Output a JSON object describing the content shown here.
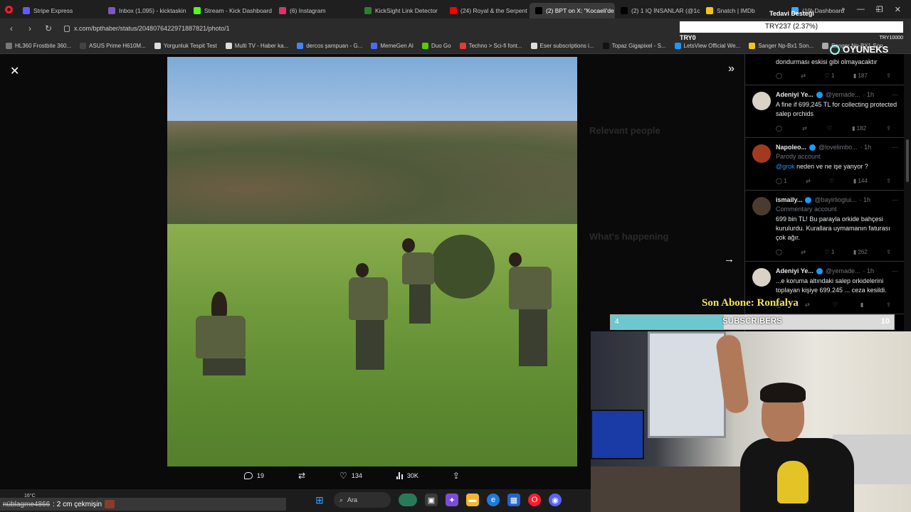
{
  "browser": {
    "tabs": [
      {
        "label": "Stripe Express",
        "color": "#635bff",
        "active": false
      },
      {
        "label": "Inbox (1,095) - kicktaskin",
        "color": "#7e57c2",
        "active": false
      },
      {
        "label": "Stream - Kick Dashboard",
        "color": "#53fc18",
        "active": false
      },
      {
        "label": "(6) Instagram",
        "color": "#e1306c",
        "active": false
      },
      {
        "label": "KickSight Link Detector",
        "color": "#2e7d32",
        "active": false
      },
      {
        "label": "(24) Royal & the Serpent",
        "color": "#ff0000",
        "active": false
      },
      {
        "label": "(2) BPT on X: \"Kocaeli'de",
        "color": "#000000",
        "active": true
      },
      {
        "label": "(2) 1 IQ İNSANLAR (@1c",
        "color": "#000000",
        "active": false
      },
      {
        "label": "Snatch | IMDb",
        "color": "#f5c518",
        "active": false
      },
      {
        "label": "(10) Dashboard",
        "color": "#3ea6ff",
        "active": false
      }
    ],
    "new_tab": "+",
    "url": "x.com/bpthaber/status/2048076422971887821/photo/1",
    "bookmarks": [
      {
        "label": "HL360 Frostbite 360...",
        "color": "#777"
      },
      {
        "label": "ASUS Prime H610M...",
        "color": "#444"
      },
      {
        "label": "Yorgunluk Tespit Test",
        "color": "#ddd"
      },
      {
        "label": "Multi TV - Haber ka...",
        "color": "#ddd"
      },
      {
        "label": "dercos şampuan - G...",
        "color": "#4285f4"
      },
      {
        "label": "MemeGen AI",
        "color": "#4a6cf7"
      },
      {
        "label": "Duo Go",
        "color": "#58cc02"
      },
      {
        "label": "Techno > Sci-fi font...",
        "color": "#e53935"
      },
      {
        "label": "Eser subscriptions i...",
        "color": "#ddd"
      },
      {
        "label": "Topaz Gigapixel - S...",
        "color": "#111"
      },
      {
        "label": "LetsView Official We...",
        "color": "#2196f3"
      },
      {
        "label": "Sanger Np-Bx1 Son...",
        "color": "#f5c518"
      },
      {
        "label": "Sanger Np-BX1 Son...",
        "color": "#aaa"
      }
    ]
  },
  "post": {
    "actions": {
      "replies": "19",
      "likes": "134",
      "views": "30K"
    }
  },
  "background_sidebar": {
    "relevant_people": "Relevant people",
    "whats_happening": "What's happening"
  },
  "replies": {
    "top_fragment": "dondurması eskisi gibi olmayacaktır",
    "top_views": "187",
    "items": [
      {
        "name": "Adeniyi Ye...",
        "handle": "@yemade...",
        "time": "· 1h",
        "label": "",
        "mention": "",
        "text": "A fine if 699,245 TL for collecting protected salep orchids",
        "reply_count": "",
        "like_count": "",
        "views": "182",
        "avatar_color": "#d9d2c5"
      },
      {
        "name": "Napoleo...",
        "handle": "@lovelimbo...",
        "time": "· 1h",
        "label": "Parody account",
        "mention": "@grok",
        "text": " neden ve ne işe yanyor ?",
        "reply_count": "1",
        "like_count": "",
        "views": "144",
        "avatar_color": "#a33a1f"
      },
      {
        "name": "ismaily...",
        "handle": "@bayirliogiui...",
        "time": "· 1h",
        "label": "Commentary account",
        "mention": "",
        "text": "699 bin TL! Bu parayla orkide bahçesi kurulurdu. Kurallara uymamanın faturası çok ağır.",
        "reply_count": "",
        "like_count": "1",
        "views": "262",
        "avatar_color": "#4b3a2e"
      },
      {
        "name": "Adeniyi Ye...",
        "handle": "@yemade...",
        "time": "· 1h",
        "label": "",
        "mention": "",
        "text": "...e koruma altındaki salep orkidelerini toplayan kişiye 699.245 ... ceza kesildi.",
        "reply_count": "",
        "like_count": "",
        "views": "",
        "avatar_color": "#d9d2c5"
      }
    ],
    "first_likes": "1"
  },
  "stream": {
    "ticker_title": "Tedavi Desteği",
    "ticker_value": "TRY237 (2.37%)",
    "ticker_left": "TRY0",
    "ticker_right": "TRY10000",
    "brand": "OYUNEKS",
    "last_subscriber": "Son Abone: Ronfalya",
    "sub_goal": {
      "current": "4",
      "label": "SUBSCRIBERS",
      "target": "10",
      "progress": 0.4
    },
    "chat_user": "nüblagme4866",
    "chat_message": ": 2 cm çekmişin"
  },
  "taskbar": {
    "weather": "16°C",
    "search_placeholder": "Ara"
  }
}
